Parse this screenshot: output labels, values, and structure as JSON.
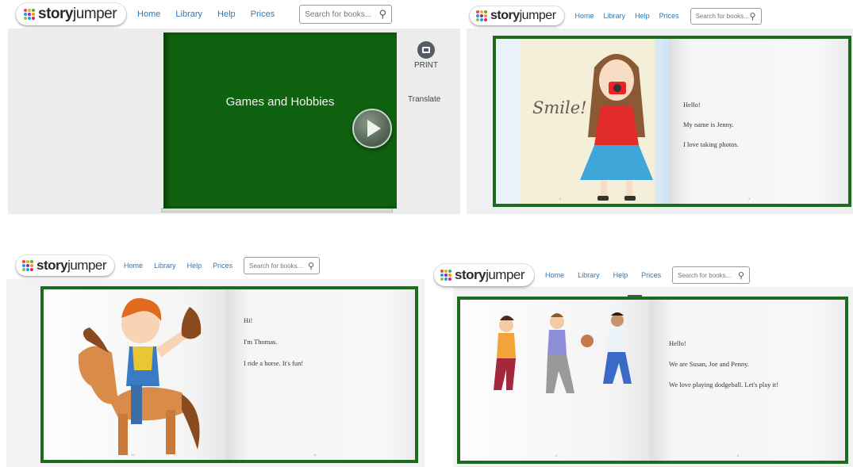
{
  "nav": {
    "home": "Home",
    "library": "Library",
    "help": "Help",
    "prices": "Prices"
  },
  "search": {
    "placeholder": "Search for books..."
  },
  "logo": {
    "part1": "story",
    "part2": "jumper",
    "dot_colors": [
      "#e94b3c",
      "#f5a623",
      "#4caf50",
      "#2196f3",
      "#9c27b0",
      "#ff9800",
      "#8bc34a",
      "#03a9f4",
      "#e91e63"
    ]
  },
  "cover": {
    "title": "Games and Hobbies",
    "print_label": "PRINT",
    "translate_label": "Translate",
    "cover_color": "#0f620f"
  },
  "page_jenny": {
    "word": "Smile!",
    "lines": [
      "Hello!",
      "My name is Jenny.",
      "I love taking photos."
    ]
  },
  "page_thomas": {
    "lines": [
      "Hi!",
      "I'm Thomas.",
      "I ride a horse. It's fun!"
    ]
  },
  "page_kids": {
    "lines": [
      "Hello!",
      "We are Susan, Joe and Penny.",
      "We love playing dodgeball. Let's play it!"
    ]
  },
  "colors": {
    "accent": "#2f77b3",
    "frame": "#1d6b1d",
    "cover": "#0f620f"
  }
}
